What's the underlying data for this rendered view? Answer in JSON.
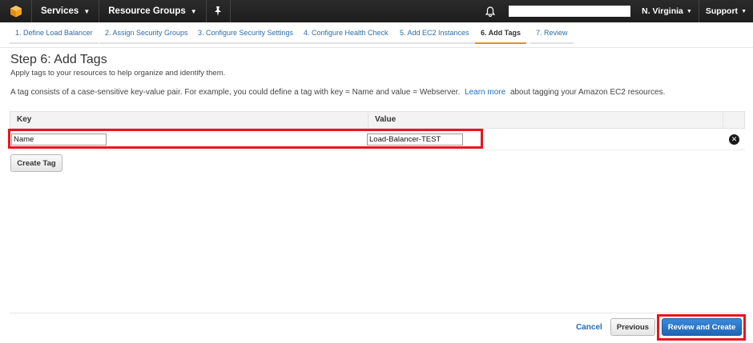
{
  "topbar": {
    "services_label": "Services",
    "resource_groups_label": "Resource Groups",
    "region_label": "N. Virginia",
    "support_label": "Support"
  },
  "steps": [
    {
      "label": "1. Define Load Balancer"
    },
    {
      "label": "2. Assign Security Groups"
    },
    {
      "label": "3. Configure Security Settings"
    },
    {
      "label": "4. Configure Health Check"
    },
    {
      "label": "5. Add EC2 Instances"
    },
    {
      "label": "6. Add Tags",
      "active": true
    },
    {
      "label": "7. Review"
    }
  ],
  "main": {
    "title": "Step 6: Add Tags",
    "subtitle": "Apply tags to your resources to help organize and identify them.",
    "desc_before": "A tag consists of a case-sensitive key-value pair. For example, you could define a tag with key = Name and value = Webserver.",
    "desc_link": "Learn more",
    "desc_after": "about tagging your Amazon EC2 resources."
  },
  "table": {
    "headers": {
      "key": "Key",
      "value": "Value"
    },
    "rows": [
      {
        "key": "Name",
        "value": "Load-Balancer-TEST"
      }
    ]
  },
  "buttons": {
    "create_tag": "Create Tag",
    "cancel": "Cancel",
    "previous": "Previous",
    "review_and_create": "Review and Create"
  },
  "colors": {
    "nav_bg": "#1d1d1d",
    "link": "#1f6fbd",
    "active_step_underline": "#e88c2c",
    "primary_button": "#1d66b6",
    "highlight": "#e8151b"
  }
}
